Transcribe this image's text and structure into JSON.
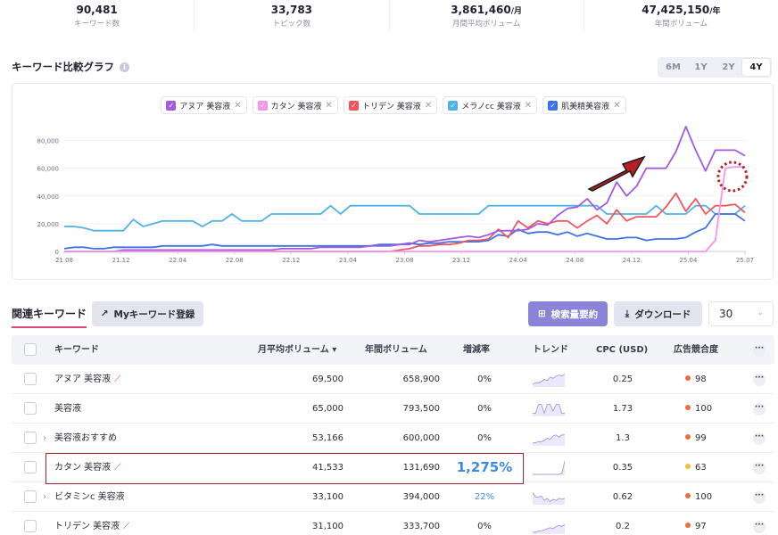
{
  "stats": [
    {
      "value": "90,481",
      "unit": "",
      "label": "キーワード数"
    },
    {
      "value": "33,783",
      "unit": "",
      "label": "トピック数"
    },
    {
      "value": "3,861,460",
      "unit": "/月",
      "label": "月間平均ボリューム"
    },
    {
      "value": "47,425,150",
      "unit": "/年",
      "label": "年間ボリューム"
    }
  ],
  "graph": {
    "title": "キーワード比較グラフ",
    "info_icon": "info-icon",
    "ranges": [
      "6M",
      "1Y",
      "2Y",
      "4Y"
    ],
    "active_range": "4Y",
    "legend": [
      {
        "label": "アヌア 美容液",
        "color": "#a35ae0"
      },
      {
        "label": "カタン 美容液",
        "color": "#f595ec"
      },
      {
        "label": "トリデン 美容液",
        "color": "#f0575d"
      },
      {
        "label": "メラノcc 美容液",
        "color": "#4fb3e8"
      },
      {
        "label": "肌美精美容液",
        "color": "#3b74e6"
      }
    ]
  },
  "chart_data": {
    "type": "line",
    "x": [
      "21.08",
      "21.12",
      "22.04",
      "22.08",
      "22.12",
      "23.04",
      "23.08",
      "23.12",
      "24.04",
      "24.08",
      "24.12",
      "25.04",
      "25.07"
    ],
    "ylim": [
      0,
      90000
    ],
    "yticks": [
      "0",
      "20,000",
      "40,000",
      "60,000",
      "80,000"
    ],
    "series": [
      {
        "name": "アヌア 美容液",
        "color": "#a35ae0",
        "values": [
          0,
          0,
          0,
          0,
          0,
          0,
          1000,
          1000,
          1000,
          1000,
          1000,
          1000,
          1000,
          1000,
          1000,
          1000,
          1000,
          1000,
          1000,
          1000,
          1000,
          1000,
          2000,
          2000,
          2000,
          2000,
          3000,
          3000,
          3000,
          3000,
          3000,
          4000,
          4000,
          4000,
          5000,
          5000,
          8000,
          7000,
          8000,
          9000,
          10000,
          11000,
          10000,
          12000,
          15000,
          15000,
          15000,
          16000,
          20000,
          19000,
          26000,
          31000,
          32000,
          38000,
          30000,
          35000,
          50000,
          40000,
          47000,
          60000,
          60000,
          60000,
          72000,
          90000,
          73000,
          58000,
          73000,
          73000,
          73000,
          69000
        ]
      },
      {
        "name": "カタン 美容液",
        "color": "#f595ec",
        "values": [
          0,
          0,
          0,
          0,
          0,
          0,
          0,
          0,
          0,
          0,
          0,
          0,
          0,
          0,
          0,
          0,
          0,
          0,
          0,
          0,
          0,
          0,
          0,
          0,
          0,
          0,
          0,
          0,
          0,
          0,
          0,
          0,
          0,
          0,
          0,
          0,
          0,
          0,
          0,
          0,
          0,
          0,
          0,
          0,
          0,
          0,
          0,
          0,
          0,
          0,
          0,
          0,
          0,
          0,
          0,
          0,
          0,
          0,
          0,
          0,
          0,
          0,
          0,
          0,
          0,
          0,
          8000,
          60000,
          61000,
          61000
        ]
      },
      {
        "name": "トリデン 美容液",
        "color": "#f0575d",
        "values": [
          0,
          0,
          0,
          0,
          0,
          0,
          0,
          0,
          0,
          0,
          0,
          0,
          0,
          0,
          0,
          0,
          0,
          0,
          0,
          0,
          0,
          0,
          0,
          0,
          0,
          0,
          0,
          0,
          0,
          0,
          0,
          0,
          0,
          0,
          1000,
          2000,
          4000,
          4000,
          5000,
          5000,
          6000,
          8000,
          8000,
          9000,
          16000,
          10000,
          22000,
          17000,
          22000,
          20000,
          22000,
          22000,
          17000,
          22000,
          26000,
          20000,
          30000,
          22000,
          25000,
          25000,
          25000,
          32000,
          42000,
          29000,
          38000,
          27000,
          33000,
          33000,
          34000,
          28000
        ]
      },
      {
        "name": "メラノcc 美容液",
        "color": "#4fb3e8",
        "values": [
          18000,
          18000,
          17000,
          15000,
          15000,
          15000,
          15000,
          23000,
          18000,
          20000,
          22000,
          22000,
          22000,
          22000,
          18000,
          22000,
          22000,
          27000,
          22000,
          22000,
          22000,
          27000,
          27000,
          27000,
          27000,
          27000,
          27000,
          33000,
          27000,
          33000,
          33000,
          33000,
          33000,
          33000,
          33000,
          33000,
          27000,
          27000,
          27000,
          27000,
          27000,
          27000,
          27000,
          33000,
          33000,
          33000,
          33000,
          33000,
          33000,
          33000,
          33000,
          33000,
          33000,
          33000,
          33000,
          27000,
          27000,
          27000,
          27000,
          27000,
          33000,
          27000,
          27000,
          27000,
          33000,
          33000,
          27000,
          27000,
          27000,
          33000
        ]
      },
      {
        "name": "肌美精美容液",
        "color": "#3b74e6",
        "values": [
          2000,
          3000,
          3000,
          2000,
          2000,
          3000,
          3000,
          3000,
          3000,
          3000,
          4000,
          4000,
          4000,
          4000,
          4000,
          5000,
          4000,
          4000,
          4000,
          4000,
          4000,
          4000,
          4000,
          4000,
          4000,
          4000,
          4000,
          4000,
          4000,
          4000,
          4000,
          4000,
          5000,
          5000,
          5000,
          6000,
          5000,
          6000,
          6000,
          7000,
          7000,
          7000,
          7000,
          8000,
          12000,
          11000,
          16000,
          13000,
          14000,
          14000,
          12000,
          14000,
          11000,
          13000,
          11000,
          9000,
          9000,
          10000,
          10000,
          8000,
          9000,
          9000,
          9000,
          10000,
          14000,
          17000,
          27000,
          27000,
          27000,
          22000
        ]
      }
    ]
  },
  "related": {
    "title": "関連キーワード",
    "my_keyword_button": "Myキーワード登録",
    "summary_button": "検索量要約",
    "download_button": "ダウンロード",
    "page_size": "30",
    "columns": {
      "keyword": "キーワード",
      "avg_volume": "月平均ボリューム",
      "sort_icon": "▾",
      "annual_volume": "年間ボリューム",
      "growth": "増減率",
      "trend": "トレンド",
      "cpc": "CPC (USD)",
      "competition": "広告競合度"
    },
    "rows": [
      {
        "keyword": "アヌア 美容液",
        "trend_icon": true,
        "expand": false,
        "avg": "69,500",
        "annual": "658,900",
        "growth": "0%",
        "growth_color": "#2b2d36",
        "cpc": "0.25",
        "comp": "98",
        "comp_color": "#f06a3c"
      },
      {
        "keyword": "美容液",
        "trend_icon": false,
        "expand": false,
        "avg": "65,000",
        "annual": "793,500",
        "growth": "0%",
        "growth_color": "#2b2d36",
        "cpc": "1.73",
        "comp": "100",
        "comp_color": "#f06a3c"
      },
      {
        "keyword": "美容液おすすめ",
        "trend_icon": false,
        "expand": true,
        "avg": "53,166",
        "annual": "600,000",
        "growth": "0%",
        "growth_color": "#2b2d36",
        "cpc": "1.3",
        "comp": "99",
        "comp_color": "#f06a3c"
      },
      {
        "keyword": "カタン 美容液",
        "trend_icon": true,
        "expand": false,
        "avg": "41,533",
        "annual": "131,690",
        "growth": "1,275%",
        "growth_color": "#3d8be0",
        "cpc": "0.35",
        "comp": "63",
        "comp_color": "#f2c12e"
      },
      {
        "keyword": "ビタミンc 美容液",
        "trend_icon": false,
        "expand": true,
        "avg": "33,100",
        "annual": "394,000",
        "growth": "22%",
        "growth_color": "#3d8be0",
        "cpc": "0.62",
        "comp": "100",
        "comp_color": "#f06a3c"
      },
      {
        "keyword": "トリデン 美容液",
        "trend_icon": true,
        "expand": false,
        "avg": "31,100",
        "annual": "333,700",
        "growth": "0%",
        "growth_color": "#2b2d36",
        "cpc": "0.2",
        "comp": "97",
        "comp_color": "#f06a3c"
      }
    ]
  }
}
